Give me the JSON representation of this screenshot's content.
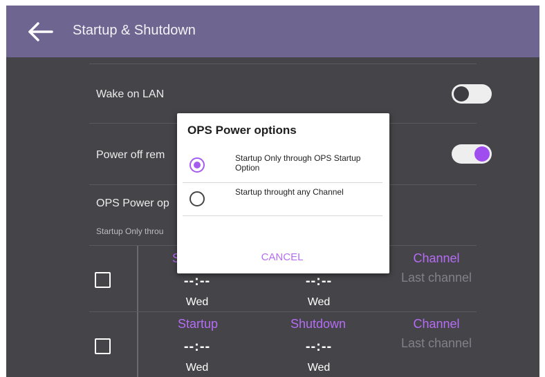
{
  "header": {
    "title": "Startup & Shutdown",
    "back_icon": "arrow-left-icon"
  },
  "settings": {
    "wake_on_lan": {
      "label": "Wake on LAN",
      "enabled": false
    },
    "power_off_reminder": {
      "label": "Power off rem",
      "enabled": true
    },
    "ops_power": {
      "label": "OPS Power op",
      "value": "Startup Only throu"
    }
  },
  "schedule": {
    "rows": [
      {
        "startup_label": "S",
        "shutdown_label": "",
        "channel_label": "Channel",
        "startup_time": "--:--",
        "shutdown_time": "--:--",
        "startup_day": "Wed",
        "shutdown_day": "Wed",
        "channel_value": "Last channel"
      },
      {
        "startup_label": "Startup",
        "shutdown_label": "Shutdown",
        "channel_label": "Channel",
        "startup_time": "--:--",
        "shutdown_time": "--:--",
        "startup_day": "Wed",
        "shutdown_day": "Wed",
        "channel_value": "Last channel"
      }
    ]
  },
  "dialog": {
    "title": "OPS Power options",
    "options": [
      {
        "label": "Startup Only through OPS Startup Option",
        "selected": true
      },
      {
        "label": "Startup throught any Channel",
        "selected": false
      }
    ],
    "cancel_label": "CANCEL"
  },
  "colors": {
    "accent": "#a45cf0",
    "topbar": "#6e6590",
    "background": "#454448"
  }
}
